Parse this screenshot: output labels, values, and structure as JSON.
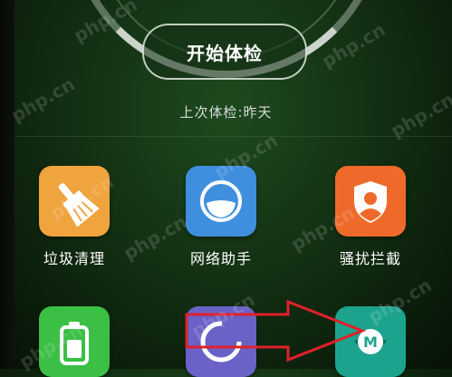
{
  "main": {
    "start_check_label": "开始体检",
    "last_check_text": "上次体检:昨天"
  },
  "tools": [
    {
      "label": "垃圾清理",
      "color": "#f0a43e",
      "icon": "broom-icon"
    },
    {
      "label": "网络助手",
      "color": "#3f8fde",
      "icon": "network-icon"
    },
    {
      "label": "骚扰拦截",
      "color": "#ef6a2a",
      "icon": "shield-user-icon"
    },
    {
      "label": "",
      "color": "#3bbf45",
      "icon": "battery-icon"
    },
    {
      "label": "",
      "color": "#6a62c6",
      "icon": "circle-progress-icon"
    },
    {
      "label": "",
      "color": "#1ca38e",
      "icon": "m-badge-icon"
    }
  ],
  "overlay": {
    "watermark": "php.cn",
    "arrow_color": "#e0202a"
  }
}
